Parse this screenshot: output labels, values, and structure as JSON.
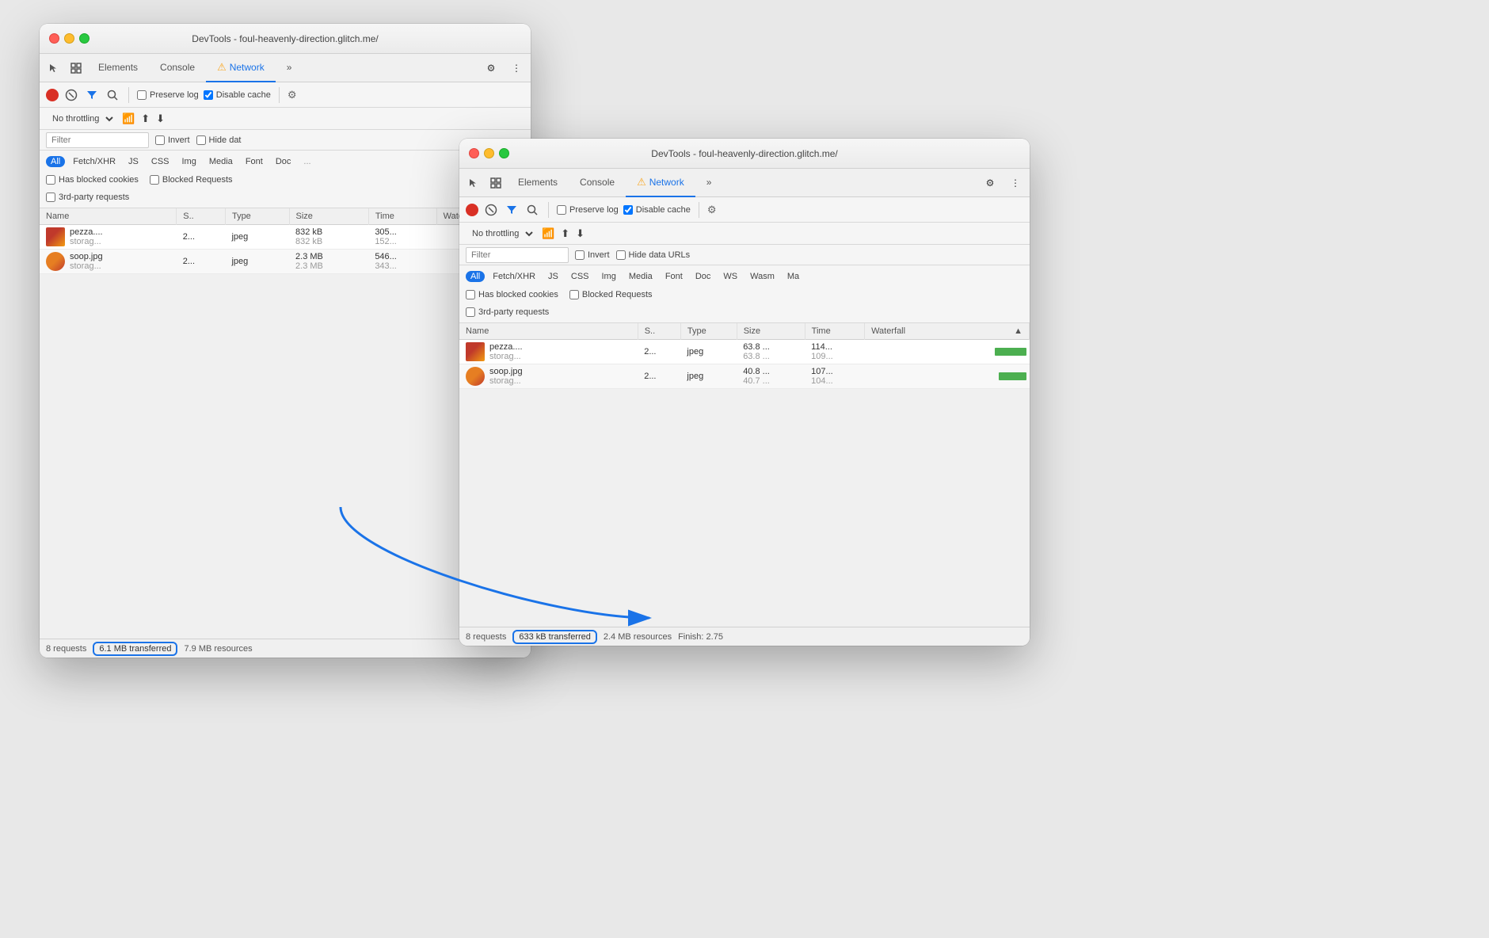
{
  "window_back": {
    "title": "DevTools - foul-heavenly-direction.glitch.me/",
    "tabs": [
      {
        "label": "Elements",
        "active": false
      },
      {
        "label": "Console",
        "active": false
      },
      {
        "label": "Network",
        "active": true,
        "warning": true
      },
      {
        "label": "»",
        "active": false
      }
    ],
    "toolbar": {
      "preserve_log_label": "Preserve log",
      "disable_cache_label": "Disable cache",
      "disable_cache_checked": true
    },
    "throttle": {
      "value": "No throttling"
    },
    "filter_placeholder": "Filter",
    "filter_options": {
      "invert": "Invert",
      "hide_data": "Hide dat"
    },
    "type_filters": [
      "All",
      "Fetch/XHR",
      "JS",
      "CSS",
      "Img",
      "Media",
      "Font",
      "Doc"
    ],
    "checkboxes": {
      "has_blocked": "Has blocked cookies",
      "blocked_requests": "Blocked Requests",
      "third_party": "3rd-party requests"
    },
    "table_headers": [
      "Name",
      "S..",
      "Type",
      "Size",
      "Time",
      "Waterfall"
    ],
    "rows": [
      {
        "name": "pezza....",
        "sub": "storag...",
        "status": "2...",
        "type": "jpeg",
        "size1": "832 kB",
        "size2": "832 kB",
        "time1": "305...",
        "time2": "152...",
        "type_img": "pizza"
      },
      {
        "name": "soop.jpg",
        "sub": "storag...",
        "status": "2...",
        "type": "jpeg",
        "size1": "2.3 MB",
        "size2": "2.3 MB",
        "time1": "546...",
        "time2": "343...",
        "type_img": "soup"
      }
    ],
    "status": {
      "requests": "8 requests",
      "transferred": "6.1 MB transferred",
      "resources": "7.9 MB resources"
    }
  },
  "window_front": {
    "title": "DevTools - foul-heavenly-direction.glitch.me/",
    "tabs": [
      {
        "label": "Elements",
        "active": false
      },
      {
        "label": "Console",
        "active": false
      },
      {
        "label": "Network",
        "active": true,
        "warning": true
      },
      {
        "label": "»",
        "active": false
      }
    ],
    "toolbar": {
      "preserve_log_label": "Preserve log",
      "disable_cache_label": "Disable cache",
      "disable_cache_checked": true
    },
    "throttle": {
      "value": "No throttling"
    },
    "filter_placeholder": "Filter",
    "filter_options": {
      "invert": "Invert",
      "hide_data": "Hide data URLs"
    },
    "type_filters": [
      "All",
      "Fetch/XHR",
      "JS",
      "CSS",
      "Img",
      "Media",
      "Font",
      "Doc",
      "WS",
      "Wasm",
      "Ma"
    ],
    "checkboxes": {
      "has_blocked": "Has blocked cookies",
      "blocked_requests": "Blocked Requests",
      "third_party": "3rd-party requests"
    },
    "table_headers": [
      "Name",
      "S..",
      "Type",
      "Size",
      "Time",
      "Waterfall",
      "▲"
    ],
    "rows": [
      {
        "name": "pezza....",
        "sub": "storag...",
        "status": "2...",
        "type": "jpeg",
        "size1": "63.8 ...",
        "size2": "63.8 ...",
        "time1": "114...",
        "time2": "109...",
        "type_img": "pizza"
      },
      {
        "name": "soop.jpg",
        "sub": "storag...",
        "status": "2...",
        "type": "jpeg",
        "size1": "40.8 ...",
        "size2": "40.7 ...",
        "time1": "107...",
        "time2": "104...",
        "type_img": "soup"
      }
    ],
    "status": {
      "requests": "8 requests",
      "transferred": "633 kB transferred",
      "resources": "2.4 MB resources",
      "finish": "Finish: 2.75"
    }
  },
  "colors": {
    "accent_blue": "#1a73e8",
    "record_red": "#d93025",
    "warning_yellow": "#f9a825",
    "green": "#4caf50"
  }
}
